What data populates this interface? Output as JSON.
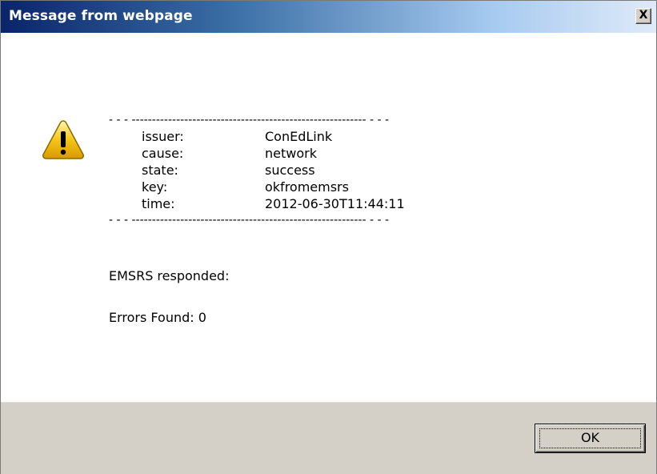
{
  "window": {
    "title": "Message from webpage",
    "close_label": "X"
  },
  "dialog": {
    "icon": "warning-icon",
    "divider_top": "- - - ---------------------------------------------------------- - - -",
    "divider_bottom": "- - - ---------------------------------------------------------- - - -",
    "fields": [
      {
        "label": "issuer:",
        "value": "ConEdLink"
      },
      {
        "label": "cause:",
        "value": "network"
      },
      {
        "label": "state:",
        "value": "success"
      },
      {
        "label": "key:",
        "value": "okfromemsrs"
      },
      {
        "label": "time:",
        "value": "2012-06-30T11:44:11"
      }
    ],
    "response_text": "EMSRS responded:",
    "errors_text": "Errors Found: 0"
  },
  "buttons": {
    "ok_label": "OK"
  },
  "colors": {
    "titlebar_start": "#0a246a",
    "titlebar_end": "#dfeaf8",
    "footer_bg": "#d4d0c8",
    "warning_fill": "#f5c518"
  }
}
